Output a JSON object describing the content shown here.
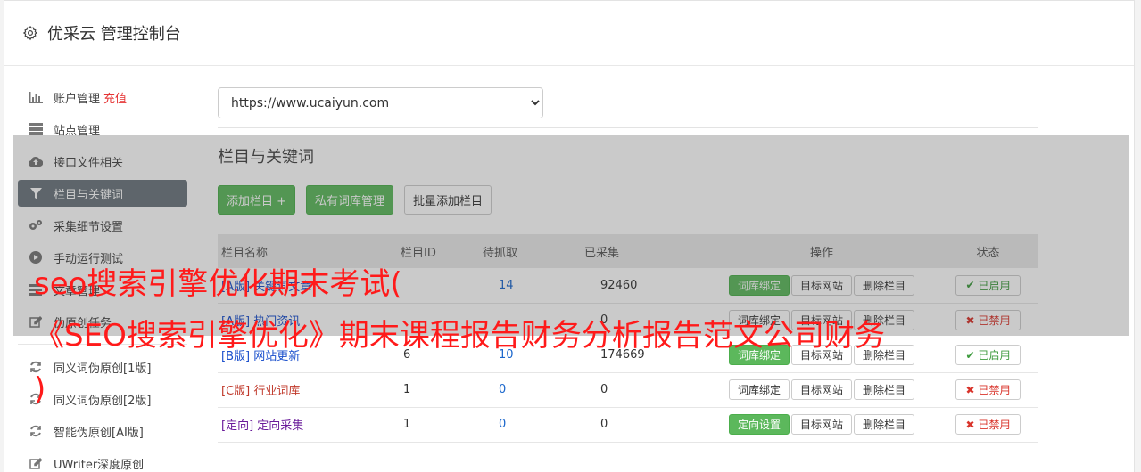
{
  "header": {
    "title": "优采云 管理控制台"
  },
  "sidebar": {
    "items": [
      {
        "label": "账户管理",
        "extra": "充值",
        "icon": "bar-chart-icon"
      },
      {
        "label": "站点管理",
        "icon": "server-icon"
      },
      {
        "label": "接口文件相关",
        "icon": "cloud-upload-icon"
      },
      {
        "label": "栏目与关键词",
        "icon": "filter-icon",
        "active": true
      },
      {
        "label": "采集细节设置",
        "icon": "gears-icon"
      },
      {
        "label": "手动运行测试",
        "icon": "play-icon"
      },
      {
        "label": "文章管理",
        "icon": "list-icon"
      },
      {
        "label": "伪原创任务",
        "icon": "edit-icon"
      }
    ],
    "items2": [
      {
        "label": "同义词伪原创[1版]",
        "icon": "refresh-icon"
      },
      {
        "label": "同义词伪原创[2版]",
        "icon": "refresh-icon"
      },
      {
        "label": "智能伪原创[AI版]",
        "icon": "refresh-icon"
      },
      {
        "label": "UWriter深度原创",
        "icon": "edit-icon"
      }
    ]
  },
  "main": {
    "site_select": "https://www.ucaiyun.com",
    "section_title": "栏目与关键词",
    "buttons": {
      "add": "添加栏目 +",
      "private": "私有词库管理",
      "batch": "批量添加栏目"
    },
    "table": {
      "headers": [
        "栏目名称",
        "栏目ID",
        "待抓取",
        "已采集",
        "操作",
        "状态"
      ],
      "rows": [
        {
          "tag": "[A版]",
          "name": "关键词文章",
          "id": "",
          "wait": "14",
          "done": "92460",
          "op1": "词库绑定",
          "op2": "目标网站",
          "op3": "删除栏目",
          "status": "已启用",
          "on": true,
          "op1green": true,
          "kind": "a"
        },
        {
          "tag": "[A版]",
          "name": "热门资讯",
          "id": "",
          "wait": "",
          "done": "0",
          "op1": "词库绑定",
          "op2": "目标网站",
          "op3": "删除栏目",
          "status": "已禁用",
          "on": false,
          "op1green": false,
          "kind": "a"
        },
        {
          "tag": "[B版]",
          "name": "网站更新",
          "id": "6",
          "wait": "10",
          "done": "174669",
          "op1": "词库绑定",
          "op2": "目标网站",
          "op3": "删除栏目",
          "status": "已启用",
          "on": true,
          "op1green": true,
          "kind": "b"
        },
        {
          "tag": "[C版]",
          "name": "行业词库",
          "id": "1",
          "wait": "0",
          "done": "0",
          "op1": "词库绑定",
          "op2": "目标网站",
          "op3": "删除栏目",
          "status": "已禁用",
          "on": false,
          "op1green": false,
          "kind": "c"
        },
        {
          "tag": "[定向]",
          "name": "定向采集",
          "id": "1",
          "wait": "0",
          "done": "0",
          "op1": "定向设置",
          "op2": "目标网站",
          "op3": "删除栏目",
          "status": "已禁用",
          "on": false,
          "op1green": true,
          "kind": "dir"
        }
      ]
    }
  },
  "overlay_text": {
    "line1": "seo搜索引擎优化期末考试(",
    "line2": "《SEO搜索引擎优化》期末课程报告财务分析报告范文公司财务",
    "line3": ")"
  },
  "colors": {
    "active_bg": "#6c757d",
    "green": "#5cb85c",
    "red_text": "#ff1a1a"
  }
}
